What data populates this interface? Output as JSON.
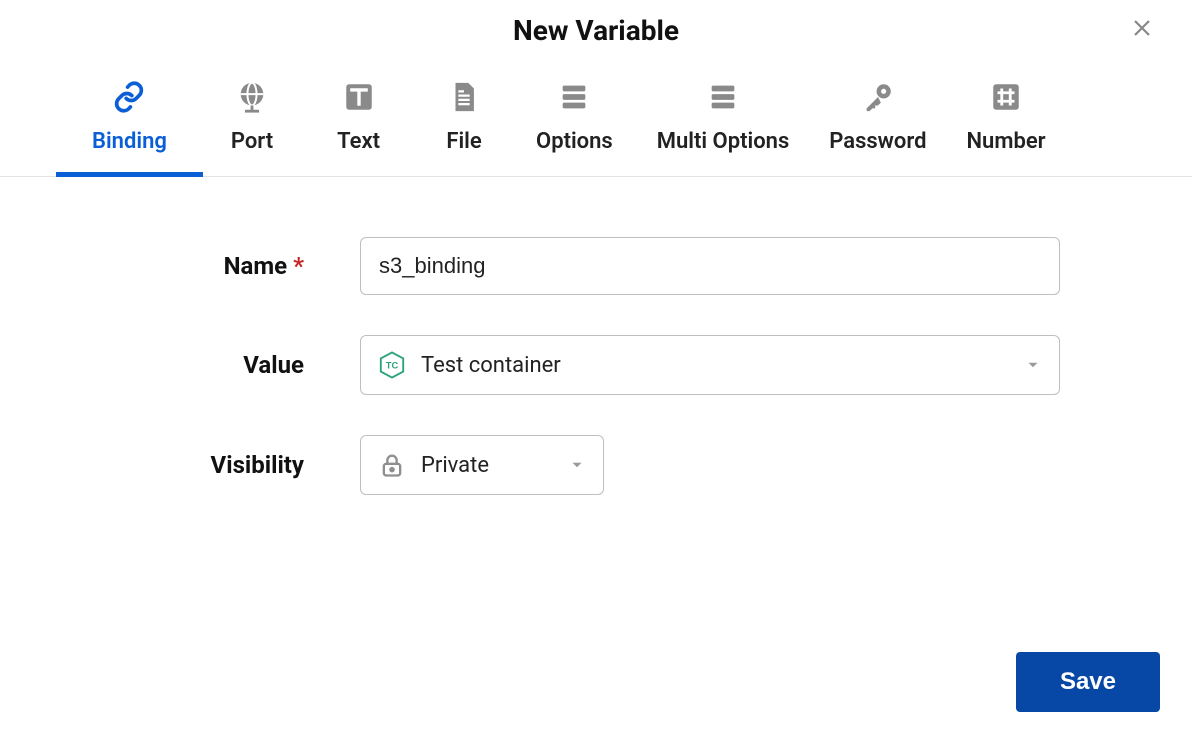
{
  "modal": {
    "title": "New Variable"
  },
  "tabs": [
    {
      "label": "Binding",
      "icon": "link-icon",
      "active": true
    },
    {
      "label": "Port",
      "icon": "globe-icon",
      "active": false
    },
    {
      "label": "Text",
      "icon": "text-icon",
      "active": false
    },
    {
      "label": "File",
      "icon": "file-icon",
      "active": false
    },
    {
      "label": "Options",
      "icon": "options-icon",
      "active": false
    },
    {
      "label": "Multi Options",
      "icon": "multi-options-icon",
      "active": false
    },
    {
      "label": "Password",
      "icon": "password-icon",
      "active": false
    },
    {
      "label": "Number",
      "icon": "number-icon",
      "active": false
    }
  ],
  "form": {
    "name": {
      "label": "Name",
      "required": true,
      "value": "s3_binding"
    },
    "value": {
      "label": "Value",
      "selected_text": "Test container",
      "badge_text": "TC"
    },
    "visibility": {
      "label": "Visibility",
      "selected_text": "Private"
    }
  },
  "actions": {
    "save_label": "Save"
  },
  "colors": {
    "accent": "#0b5fd6",
    "save_bg": "#0747a6",
    "badge_border": "#2aa37a",
    "icon_grey": "#8a8a8a",
    "border_grey": "#bfbfbf"
  }
}
